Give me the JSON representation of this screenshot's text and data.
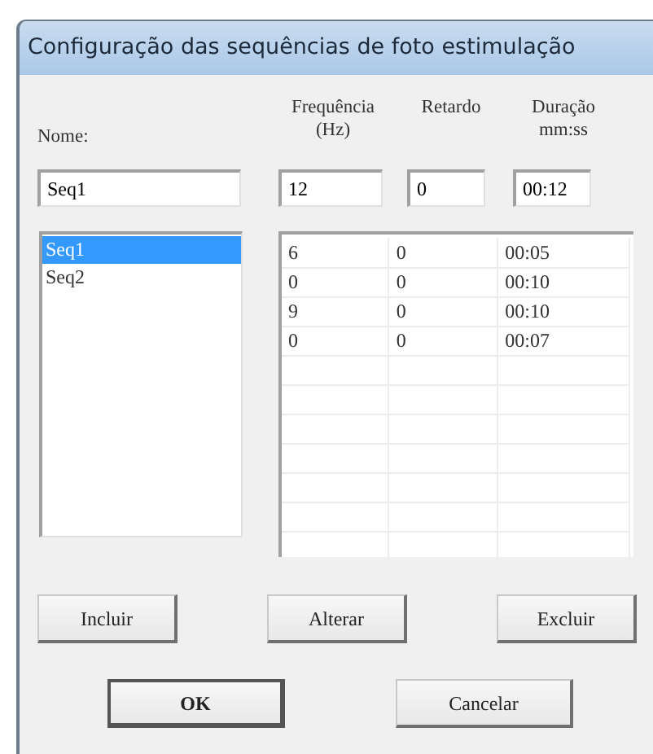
{
  "window": {
    "title": "Configuração das sequências de foto estimulação"
  },
  "fields": [
    {
      "label": "Nome:",
      "value": "Seq1"
    },
    {
      "label": "Frequência (Hz)",
      "value": "12"
    },
    {
      "label": "Retardo",
      "value": "0"
    },
    {
      "label": "Duração mm:ss",
      "value": "00:12"
    }
  ],
  "sequences": [
    {
      "label": "Seq1",
      "selected": true
    },
    {
      "label": "Seq2",
      "selected": false
    }
  ],
  "steps": [
    [
      "6",
      "0",
      "00:05"
    ],
    [
      "0",
      "0",
      "00:10"
    ],
    [
      "9",
      "0",
      "00:10"
    ],
    [
      "0",
      "0",
      "00:07"
    ]
  ],
  "action_buttons": [
    "Incluir",
    "Alterar",
    "Excluir"
  ],
  "dialog_buttons": [
    {
      "label": "OK",
      "default": true
    },
    {
      "label": "Cancelar",
      "default": false
    }
  ]
}
